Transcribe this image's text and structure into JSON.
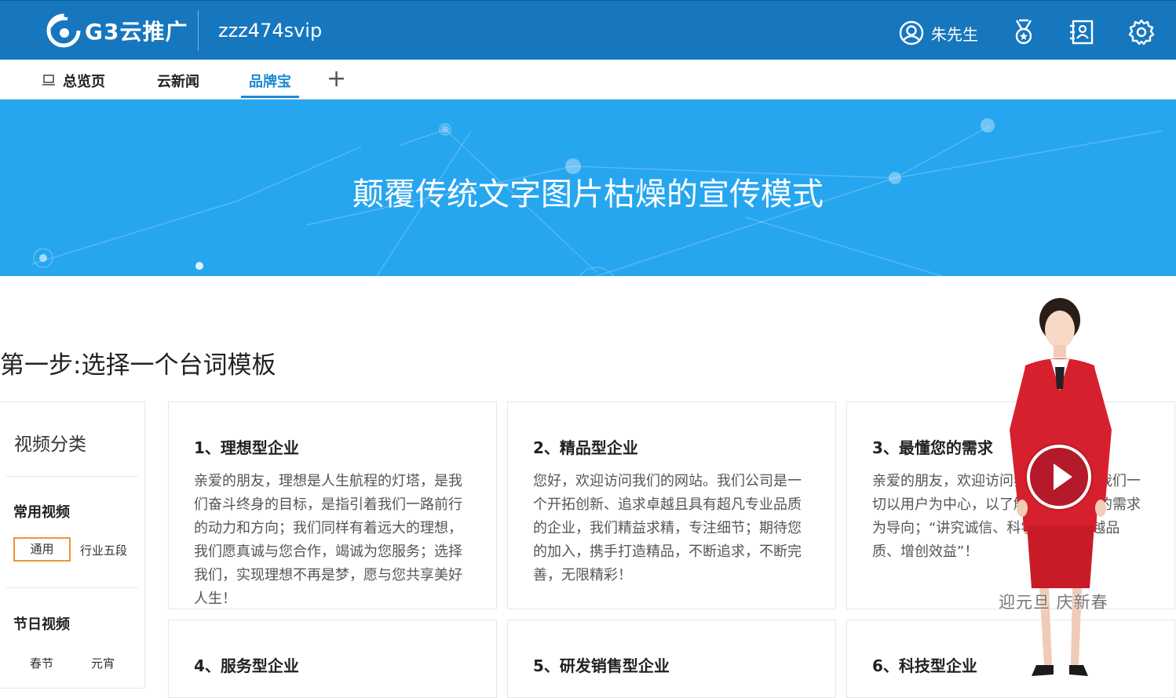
{
  "header": {
    "logo_text": "G3云推广",
    "account": "zzz474svip",
    "user_name": "朱先生",
    "icons": [
      "user-circle-icon",
      "medal-icon",
      "contacts-icon",
      "gear-icon"
    ],
    "brand_color": "#1677be"
  },
  "tabs": [
    {
      "label": "总览页",
      "icon": "monitor-icon",
      "active": false
    },
    {
      "label": "云新闻",
      "active": false
    },
    {
      "label": "品牌宝",
      "active": true
    }
  ],
  "tab_add": "+",
  "banner": {
    "title": "颠覆传统文字图片枯燥的宣传模式",
    "color": "#27a6f0"
  },
  "step": {
    "title": "第一步:选择一个台词模板"
  },
  "categories": {
    "heading": "视频分类",
    "groups": [
      {
        "name": "常用视频",
        "items": [
          {
            "label": "通用",
            "selected": true
          },
          {
            "label": "行业五段",
            "selected": false
          }
        ]
      },
      {
        "name": "节日视频",
        "items": [
          {
            "label": "春节",
            "selected": false
          },
          {
            "label": "元宵",
            "selected": false
          }
        ]
      }
    ]
  },
  "templates": [
    {
      "title": "1、理想型企业",
      "body": "亲爱的朋友，理想是人生航程的灯塔，是我们奋斗终身的目标，是指引着我们一路前行的动力和方向；我们同样有着远大的理想，我们愿真诚与您合作，竭诚为您服务；选择我们，实现理想不再是梦，愿与您共享美好人生！"
    },
    {
      "title": "2、精品型企业",
      "body": "您好，欢迎访问我们的网站。我们公司是一个开拓创新、追求卓越且具有超凡专业品质的企业，我们精益求精，专注细节；期待您的加入，携手打造精品，不断追求，不断完善，无限精彩！"
    },
    {
      "title": "3、最懂您的需求",
      "body": "亲爱的朋友，欢迎访问我们的网站！我们一切以用户为中心，以了解客户朋友们的需求为导向；“讲究诚信、科学管理、卓越品质、增创效益”！"
    },
    {
      "title": "4、服务型企业",
      "body": ""
    },
    {
      "title": "5、研发销售型企业",
      "body": ""
    },
    {
      "title": "6、科技型企业",
      "body": ""
    }
  ],
  "presenter": {
    "caption": "迎元旦  庆新春",
    "play_icon": "play-icon",
    "accent": "#d7202d"
  }
}
